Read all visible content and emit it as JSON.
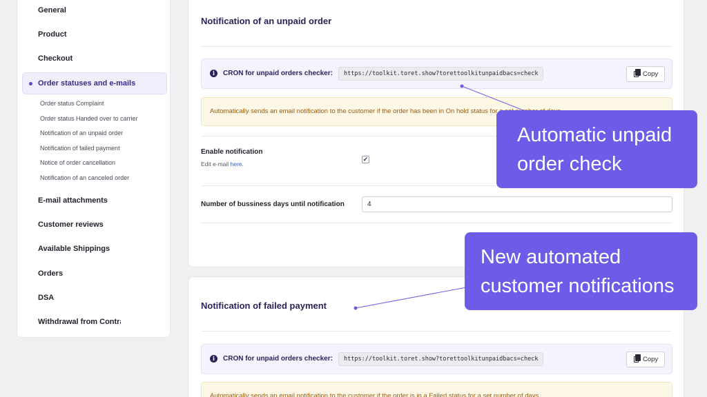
{
  "sidebar": {
    "items": [
      {
        "label": "General"
      },
      {
        "label": "Product"
      },
      {
        "label": "Checkout"
      },
      {
        "label": "Order statuses and e-mails",
        "active": true
      },
      {
        "label": "E-mail attachments"
      },
      {
        "label": "Customer reviews"
      },
      {
        "label": "Available Shippings"
      },
      {
        "label": "Orders"
      },
      {
        "label": "DSA"
      },
      {
        "label": "Withdrawal from Contra"
      }
    ],
    "subitems": [
      {
        "label": "Order status Complaint"
      },
      {
        "label": "Order status Handed over to carrier"
      },
      {
        "label": "Notification of an unpaid order"
      },
      {
        "label": "Notification of failed payment"
      },
      {
        "label": "Notice of order cancellation"
      },
      {
        "label": "Notification of an canceled order"
      }
    ]
  },
  "card1": {
    "title": "Notification of an unpaid order",
    "cron_label": "CRON for unpaid orders checker:",
    "cron_url": "https://toolkit.toret.show?torettoolkitunpaidbacs=check",
    "copy_label": "Copy",
    "notice": "Automatically sends an email notification to the customer if the order has been in On hold status for a set number of days.",
    "enable_label": "Enable notification",
    "edit_prefix": "Edit e-mail ",
    "edit_link": "here.",
    "enabled": true,
    "days_label": "Number of bussiness days until notification",
    "days_value": "4"
  },
  "card2": {
    "title": "Notification of failed payment",
    "cron_label": "CRON for unpaid orders checker:",
    "cron_url": "https://toolkit.toret.show?torettoolkitunpaidbacs=check",
    "copy_label": "Copy",
    "notice": "Automatically sends an email notification to the customer if the order is in a Failed status for a set number of days."
  },
  "callouts": {
    "top": {
      "line1": "Automatic unpaid",
      "line2": "order check"
    },
    "bottom": {
      "line1": "New automated",
      "line2": "customer notifications"
    }
  },
  "colors": {
    "accent": "#6c5ce7",
    "title": "#2b2258",
    "notice_text": "#9a5a0f",
    "notice_bg": "#fdf8e6"
  }
}
